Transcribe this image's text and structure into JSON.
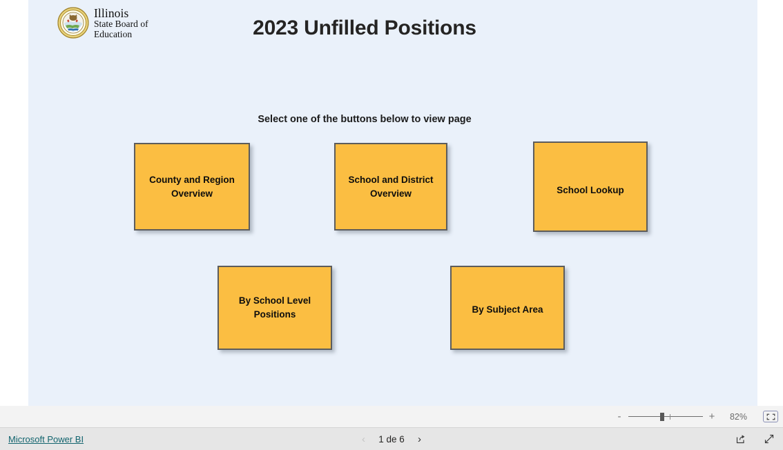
{
  "report": {
    "title": "2023 Unfilled Positions",
    "instruction": "Select one of the buttons below to view page",
    "logo": {
      "icon": "illinois-state-seal-icon",
      "line1": "Illinois",
      "line2": "State Board of",
      "line3": "Education"
    },
    "canvas_color": "#eaf1fa",
    "buttons": [
      {
        "id": "county-region",
        "label": "County and Region\nOverview"
      },
      {
        "id": "school-district",
        "label": "School and District\nOverview"
      },
      {
        "id": "school-lookup",
        "label": "School Lookup"
      },
      {
        "id": "school-level",
        "label": "By School Level\nPositions"
      },
      {
        "id": "subject-area",
        "label": "By Subject Area"
      }
    ],
    "button_fill": "#fbbe42",
    "button_border": "#5c5c5c"
  },
  "zoom_toolbar": {
    "minus_label": "-",
    "plus_label": "+",
    "percent": "82%",
    "fit_icon": "fit-to-page-icon"
  },
  "footer": {
    "brand_link": "Microsoft Power BI",
    "brand_link_color": "#12646e",
    "prev_icon": "chevron-left-icon",
    "next_icon": "chevron-right-icon",
    "prev_label": "‹",
    "next_label": "›",
    "page_indicator": "1 de 6",
    "share_icon": "share-icon",
    "fullscreen_icon": "fullscreen-icon"
  }
}
